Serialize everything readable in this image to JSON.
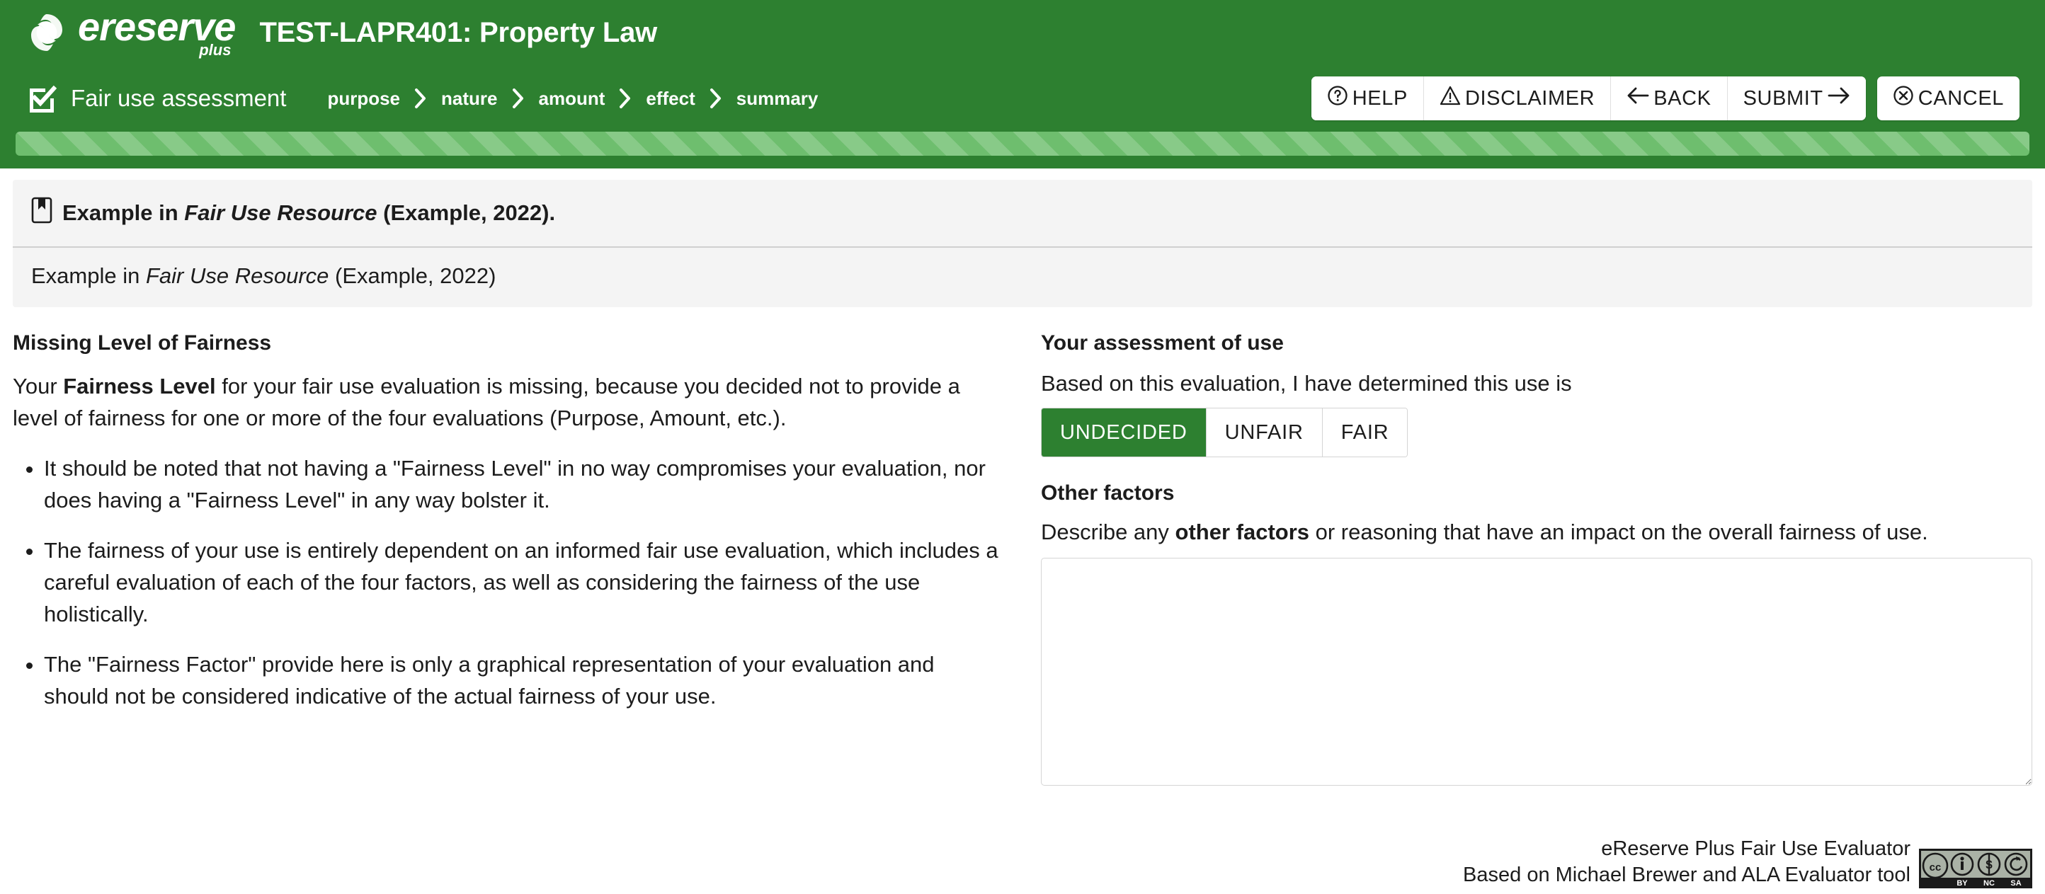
{
  "header": {
    "logo_name": "ereserve",
    "logo_sub": "plus",
    "logo_icon": "ereserve-swirl-logo",
    "course_title": "TEST-LAPR401: Property Law",
    "assessment_icon": "checkbox-checked-icon",
    "assessment_label": "Fair use assessment",
    "breadcrumbs": [
      {
        "label": "purpose"
      },
      {
        "label": "nature"
      },
      {
        "label": "amount"
      },
      {
        "label": "effect"
      },
      {
        "label": "summary"
      }
    ],
    "actions": [
      {
        "label": "HELP",
        "icon": "question-circle-icon"
      },
      {
        "label": "DISCLAIMER",
        "icon": "warning-triangle-icon"
      },
      {
        "label": "BACK",
        "icon": "arrow-left-icon"
      },
      {
        "label": "SUBMIT",
        "icon": "arrow-right-icon"
      }
    ],
    "cancel": {
      "label": "CANCEL",
      "icon": "close-circle-icon"
    },
    "accent_color": "#2d8030",
    "progress_color": "#6ebe6e"
  },
  "citation": {
    "icon": "bookmark-icon",
    "title_prefix": "Example in ",
    "title_italic": "Fair Use Resource",
    "title_suffix": " (Example, 2022).",
    "body_prefix": "Example in ",
    "body_italic": "Fair Use Resource",
    "body_suffix": " (Example, 2022)"
  },
  "left": {
    "heading": "Missing Level of Fairness",
    "paragraph_part1": "Your ",
    "paragraph_bold": "Fairness Level",
    "paragraph_part2": " for your fair use evaluation is missing, because you decided not to provide a level of fairness for one or more of the four evaluations (Purpose, Amount, etc.).",
    "bullets": [
      "It should be noted that not having a \"Fairness Level\" in no way compromises your evaluation, nor does having a \"Fairness Level\" in any way bolster it.",
      "The fairness of your use is entirely dependent on an informed fair use evaluation, which includes a careful evaluation of each of the four factors, as well as considering the fairness of the use holistically.",
      "The \"Fairness Factor\" provide here is only a graphical representation of your evaluation and should not be considered indicative of the actual fairness of your use."
    ]
  },
  "right": {
    "heading": "Your assessment of use",
    "prompt": "Based on this evaluation, I have determined this use is",
    "choices": [
      {
        "label": "UNDECIDED",
        "selected": true
      },
      {
        "label": "UNFAIR",
        "selected": false
      },
      {
        "label": "FAIR",
        "selected": false
      }
    ],
    "selected_choice": "UNDECIDED",
    "other_heading": "Other factors",
    "other_desc_part1": "Describe any ",
    "other_desc_bold": "other factors",
    "other_desc_part2": " or reasoning that have an impact on the overall fairness of use.",
    "other_value": "",
    "other_placeholder": ""
  },
  "footer": {
    "line1": "eReserve Plus Fair Use Evaluator",
    "line2": "Based on Michael Brewer and ALA Evaluator tool",
    "license_icon": "creative-commons-by-nc-sa-badge",
    "license_labels": [
      "BY",
      "NC",
      "SA"
    ]
  }
}
